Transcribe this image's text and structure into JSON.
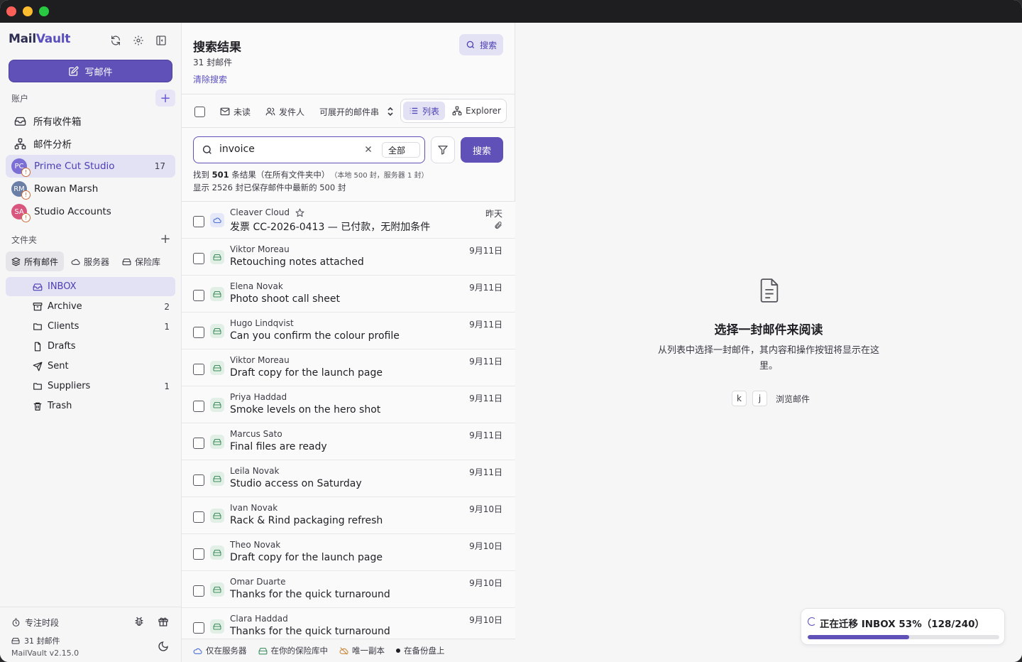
{
  "app": {
    "name_part1": "Mail",
    "name_part2": "Vault",
    "compose_label": "写邮件"
  },
  "accounts": {
    "section_label": "账户",
    "items": [
      {
        "label": "所有收件箱",
        "icon": "inbox-icon"
      },
      {
        "label": "邮件分析",
        "icon": "network-icon"
      },
      {
        "label": "Prime Cut Studio",
        "initials": "PC",
        "count": "17",
        "color": "#7b6fd6",
        "selected": true
      },
      {
        "label": "Rowan Marsh",
        "initials": "RM",
        "color": "#6b7ea6"
      },
      {
        "label": "Studio Accounts",
        "initials": "SA",
        "color": "#d9577f"
      }
    ]
  },
  "folders": {
    "section_label": "文件夹",
    "tabs": [
      {
        "label": "所有邮件",
        "icon": "layers-icon",
        "selected": true
      },
      {
        "label": "服务器",
        "icon": "cloud-icon"
      },
      {
        "label": "保险库",
        "icon": "drive-icon"
      }
    ],
    "items": [
      {
        "label": "INBOX",
        "icon": "inbox-icon",
        "count": "",
        "selected": true
      },
      {
        "label": "Archive",
        "icon": "archive-icon",
        "count": "2"
      },
      {
        "label": "Clients",
        "icon": "folder-icon",
        "count": "1"
      },
      {
        "label": "Drafts",
        "icon": "file-icon",
        "count": ""
      },
      {
        "label": "Sent",
        "icon": "send-icon",
        "count": ""
      },
      {
        "label": "Suppliers",
        "icon": "folder-icon",
        "count": "1"
      },
      {
        "label": "Trash",
        "icon": "trash-icon",
        "count": ""
      }
    ]
  },
  "sidebar_footer": {
    "focus_label": "专注时段",
    "mail_count": "31 封邮件",
    "version": "MailVault v2.15.0"
  },
  "list": {
    "title": "搜索结果",
    "count": "31 封邮件",
    "clear_label": "清除搜索",
    "search_button": "搜索",
    "toolbar": {
      "unread": "未读",
      "sender": "发件人",
      "threads": "可展开的邮件串",
      "view_list": "列表",
      "view_explorer": "Explorer"
    },
    "search": {
      "query": "invoice",
      "scope": "全部",
      "submit": "搜索"
    },
    "results_prefix": "找到 ",
    "results_count": "501",
    "results_suffix": " 条结果（在所有文件夹中）",
    "results_detail": "（本地 500 封，服务器 1 封）",
    "results_line2": "显示 2526 封已保存邮件中最新的 500 封",
    "messages": [
      {
        "from": "Cleaver Cloud",
        "subject": "发票 CC-2026-0413 — 已付款，无附加条件",
        "date": "昨天",
        "source": "cloud",
        "starred": true,
        "attachment": true
      },
      {
        "from": "Viktor Moreau",
        "subject": "Retouching notes attached",
        "date": "9月11日",
        "source": "drive"
      },
      {
        "from": "Elena Novak",
        "subject": "Photo shoot call sheet",
        "date": "9月11日",
        "source": "drive"
      },
      {
        "from": "Hugo Lindqvist",
        "subject": "Can you confirm the colour profile",
        "date": "9月11日",
        "source": "drive"
      },
      {
        "from": "Viktor Moreau",
        "subject": "Draft copy for the launch page",
        "date": "9月11日",
        "source": "drive"
      },
      {
        "from": "Priya Haddad",
        "subject": "Smoke levels on the hero shot",
        "date": "9月11日",
        "source": "drive"
      },
      {
        "from": "Marcus Sato",
        "subject": "Final files are ready",
        "date": "9月11日",
        "source": "drive"
      },
      {
        "from": "Leila Novak",
        "subject": "Studio access on Saturday",
        "date": "9月11日",
        "source": "drive"
      },
      {
        "from": "Ivan Novak",
        "subject": "Rack & Rind packaging refresh",
        "date": "9月10日",
        "source": "drive"
      },
      {
        "from": "Theo Novak",
        "subject": "Draft copy for the launch page",
        "date": "9月10日",
        "source": "drive"
      },
      {
        "from": "Omar Duarte",
        "subject": "Thanks for the quick turnaround",
        "date": "9月10日",
        "source": "drive"
      },
      {
        "from": "Clara Haddad",
        "subject": "Thanks for the quick turnaround",
        "date": "9月10日",
        "source": "drive"
      }
    ],
    "legend": [
      {
        "label": "仅在服务器",
        "icon": "cloud-icon"
      },
      {
        "label": "在你的保险库中",
        "icon": "drive-icon"
      },
      {
        "label": "唯一副本",
        "icon": "cloud-off-icon"
      },
      {
        "label": "在备份盘上",
        "icon": "dot-icon"
      }
    ]
  },
  "reader": {
    "title": "选择一封邮件来阅读",
    "description": "从列表中选择一封邮件，其内容和操作按钮将显示在这里。",
    "key1": "k",
    "key2": "j",
    "key_hint": "浏览邮件"
  },
  "migration": {
    "text": "正在迁移 INBOX 53%（128/240）",
    "progress": 0.53
  },
  "colors": {
    "accent": "#5f51b8",
    "accent_soft": "#e3e1f4",
    "vault_green": "#3f8f5f",
    "cloud_blue": "#4a6fd6"
  }
}
